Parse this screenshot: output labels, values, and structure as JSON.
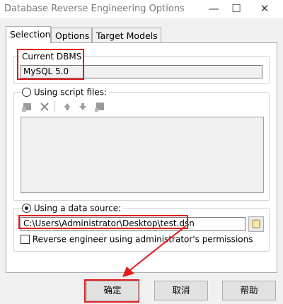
{
  "window": {
    "title": "Database Reverse Engineering Options",
    "minimize_glyph": "—",
    "maximize_glyph": "☐",
    "close_glyph": "✕"
  },
  "tabs": [
    {
      "label": "Selection",
      "active": true
    },
    {
      "label": "Options",
      "active": false
    },
    {
      "label": "Target Models",
      "active": false
    }
  ],
  "dbms": {
    "group_label": "Current DBMS",
    "value": "MySQL 5.0"
  },
  "script_files": {
    "radio_label": "Using script files:",
    "selected": false,
    "toolbar_icons": [
      "add-file-icon",
      "delete-icon",
      "move-up-icon",
      "move-down-icon",
      "disabled-file-icon"
    ]
  },
  "data_source": {
    "radio_label": "Using a data source:",
    "selected": true,
    "path": "C:\\Users\\Administrator\\Desktop\\test.dsn",
    "browse_icon": "browse-data-source-icon"
  },
  "admin_option": {
    "label": "Reverse engineer using administrator's permissions",
    "checked": false
  },
  "buttons": {
    "ok": "确定",
    "cancel": "取消",
    "help": "帮助"
  },
  "colors": {
    "highlight_red": "#e21b1b",
    "window_bg": "#f0f0f0"
  }
}
